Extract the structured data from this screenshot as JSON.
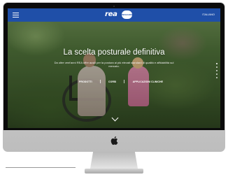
{
  "site": {
    "logo": "rea",
    "badge": "INVACARE",
    "language": "ITALIANO"
  },
  "hero": {
    "title": "La scelta posturale definitiva",
    "subtitle": "Da oltre vent'anni REA offre ausili per la postura ai più elevati standard di qualità e affidabilità sul mercato.",
    "buttons": [
      "PRODOTTI",
      "CORSI",
      "APPLICAZIONI CLINICHE"
    ]
  },
  "slider": {
    "dot_count": 5,
    "active_index": 0
  }
}
